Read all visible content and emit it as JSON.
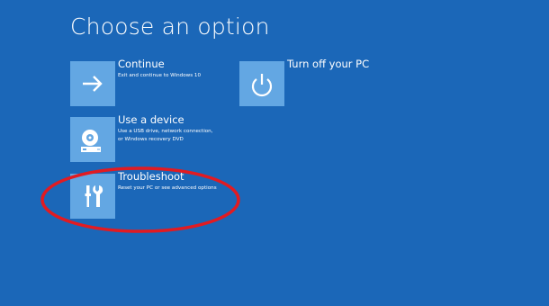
{
  "page": {
    "title": "Choose an option",
    "background_color": "#1b67b8",
    "tile_color": "#63a7e3",
    "highlight_color": "#e11b22"
  },
  "options": [
    {
      "label": "Continue",
      "description": [
        "Exit and continue to Windows 10"
      ],
      "icon": "arrow-right-icon"
    },
    {
      "label": "Turn off your PC",
      "description": [],
      "icon": "power-icon"
    },
    {
      "label": "Use a device",
      "description": [
        "Use a USB drive, network connection,",
        "or Windows recovery DVD"
      ],
      "icon": "disc-drive-icon"
    },
    {
      "label": "Troubleshoot",
      "description": [
        "Reset your PC or see advanced options"
      ],
      "icon": "tools-icon"
    }
  ],
  "annotation": {
    "type": "red-ellipse",
    "target": "Troubleshoot"
  }
}
